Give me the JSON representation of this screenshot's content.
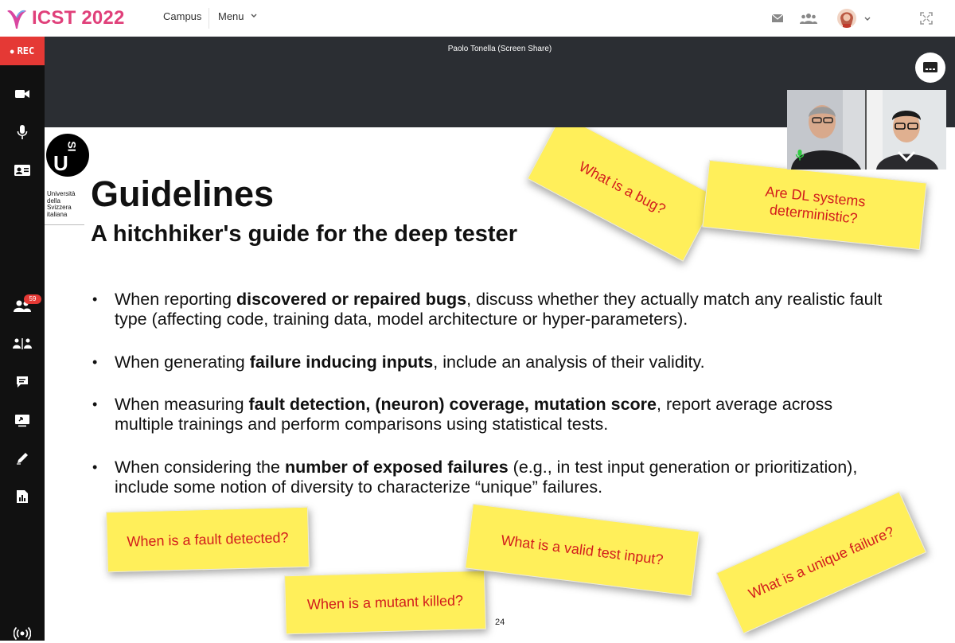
{
  "app": {
    "logo_text": "ICST 2022"
  },
  "nav": {
    "campus": "Campus",
    "menu": "Menu"
  },
  "sidebar": {
    "rec_label": "REC",
    "participants_badge": "59"
  },
  "meeting": {
    "share_title": "Paolo Tonella (Screen Share)"
  },
  "slide": {
    "university_lines": [
      "Università",
      "della",
      "Svizzera",
      "italiana"
    ],
    "title": "Guidelines",
    "subtitle": "A hitchhiker's guide for the deep tester",
    "bullets": [
      {
        "pre": "When reporting ",
        "bold": "discovered or repaired bugs",
        "post": ", discuss whether they actually match any realistic fault type (affecting code, training data, model architecture or hyper-parameters)."
      },
      {
        "pre": "When generating ",
        "bold": "failure inducing inputs",
        "post": ", include an analysis of their validity."
      },
      {
        "pre": "When measuring ",
        "bold": "fault detection, (neuron) coverage, mutation score",
        "post": ", report average across multiple trainings and perform comparisons using statistical tests."
      },
      {
        "pre": "When considering the ",
        "bold": "number of exposed failures",
        "post": " (e.g., in test input generation or prioritization), include some notion of diversity to characterize “unique” failures."
      }
    ],
    "notes": {
      "bug": "What is a bug?",
      "deterministic": "Are DL systems deterministic?",
      "fault_detected": "When is a fault detected?",
      "mutant_killed": "When is a mutant killed?",
      "valid_input": "What is a valid test input?",
      "unique_failure": "What is a unique failure?"
    },
    "page_number": "24"
  },
  "colors": {
    "accent": "#e0407a",
    "rec": "#e53935",
    "sidebar": "#111111",
    "note_bg": "#ffef5a",
    "note_text": "#d21c1c"
  }
}
